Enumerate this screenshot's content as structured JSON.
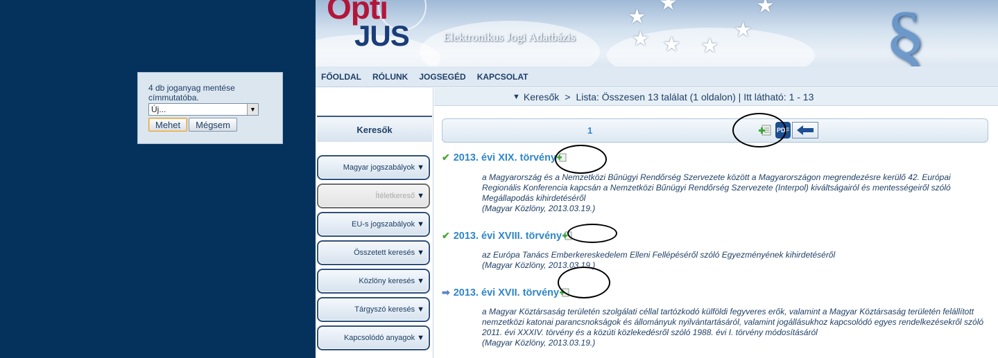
{
  "popup": {
    "message": "4 db joganyag mentése címmutatóba.",
    "select_value": "Új...",
    "ok_label": "Mehet",
    "cancel_label": "Mégsem"
  },
  "banner": {
    "logo_top": "Opti",
    "logo_bottom": "JUS",
    "tagline": "Elektronikus Jogi Adatbázis"
  },
  "nav": [
    "FŐOLDAL",
    "RÓLUNK",
    "JOGSEGÉD",
    "KAPCSOLAT"
  ],
  "sidebar": {
    "heading": "Keresők",
    "items": [
      {
        "label": "Magyar jogszabályok"
      },
      {
        "label": "Ítéletkereső"
      },
      {
        "label": "EU-s jogszabályok"
      },
      {
        "label": "Összetett keresés"
      },
      {
        "label": "Közlöny keresés"
      },
      {
        "label": "Tárgyszó keresés"
      },
      {
        "label": "Kapcsolódó anyagok"
      }
    ]
  },
  "breadcrumb": {
    "root": "Keresők",
    "separator": ">",
    "rest": "Lista: Összesen 13 találat  (1 oldalon) | Itt látható: 1 - 13"
  },
  "pager": {
    "page": "1",
    "pdf_label": "PDF"
  },
  "results": [
    {
      "title": "2013. évi XIX. törvény",
      "description": "a Magyarország és a Nemzetközi Bűnügyi Rendőrség Szervezete között a Magyarországon megrendezésre kerülő 42. Európai Regionális Konferencia kapcsán a Nemzetközi Bűnügyi Rendőrség Szervezete (Interpol) kiváltságairól és mentességeiről szóló Megállapodás kihirdetéséről",
      "source": "(Magyar Közlöny, 2013.03.19.)"
    },
    {
      "title": "2013. évi XVIII. törvény",
      "description": "az Európa Tanács Emberkereskedelem Elleni Fellépéséről szóló Egyezményének kihirdetéséről",
      "source": "(Magyar Közlöny, 2013.03.19.)"
    },
    {
      "title": "2013. évi XVII. törvény",
      "description": "a Magyar Köztársaság területén szolgálati céllal tartózkodó külföldi fegyveres erők, valamint a Magyar Köztársaság területén felállított nemzetközi katonai parancsnokságok és állományuk nyilvántartásáról, valamint jogállásukhoz kapcsolódó egyes rendelkezésekről szóló 2011. évi XXXIV. törvény és a közúti közlekedésről szóló 1988. évi I. törvény módosításáról",
      "source": "(Magyar Közlöny, 2013.03.19.)"
    }
  ]
}
